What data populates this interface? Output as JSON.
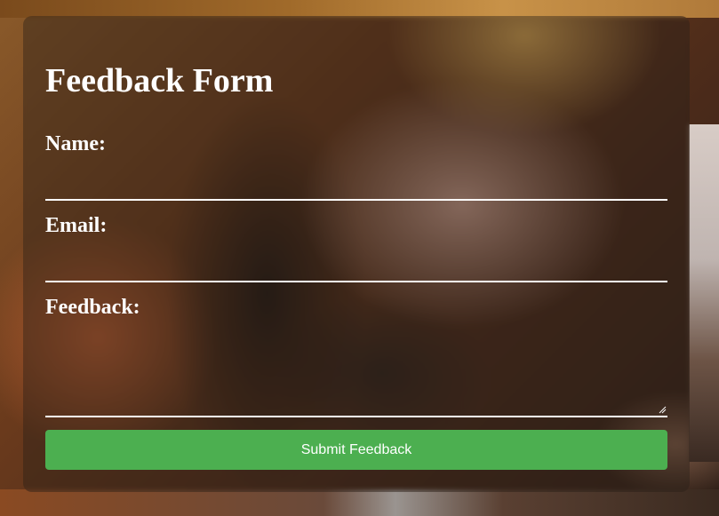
{
  "form": {
    "title": "Feedback Form",
    "fields": {
      "name": {
        "label": "Name:",
        "value": ""
      },
      "email": {
        "label": "Email:",
        "value": ""
      },
      "feedback": {
        "label": "Feedback:",
        "value": ""
      }
    },
    "submit_label": "Submit Feedback"
  },
  "colors": {
    "submit_button": "#4caf50",
    "text": "#ffffff",
    "underline": "#ffffff"
  }
}
